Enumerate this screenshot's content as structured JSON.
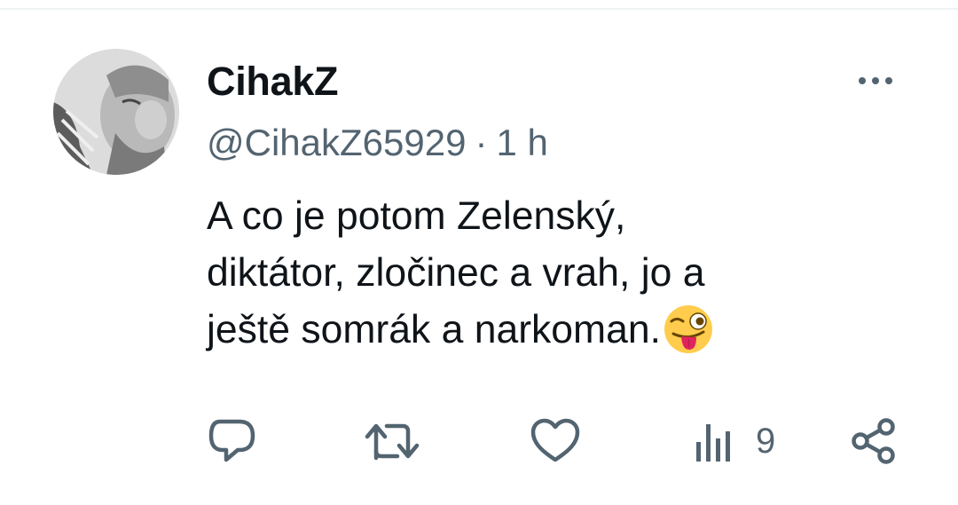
{
  "tweet": {
    "author": {
      "display_name": "CihakZ",
      "handle": "@CihakZ65929",
      "avatar_icon": "profile-photo"
    },
    "separator": "·",
    "time": "1 h",
    "text_lines": [
      "A co je potom Zelenský,",
      "diktátor, zločinec a vrah, jo a",
      "ještě somrák a narkoman."
    ],
    "emoji": "winking-face-with-tongue",
    "more_icon": "more-horizontal-icon"
  },
  "actions": {
    "reply_icon": "reply-icon",
    "repost_icon": "repost-icon",
    "like_icon": "heart-icon",
    "views_icon": "views-chart-icon",
    "views_count": "9",
    "share_icon": "share-icon"
  },
  "colors": {
    "text_primary": "#0f1419",
    "text_secondary": "#536471",
    "divider": "#eff3f4",
    "emoji_face": "#ffcc4d",
    "emoji_tongue": "#e0245e"
  }
}
